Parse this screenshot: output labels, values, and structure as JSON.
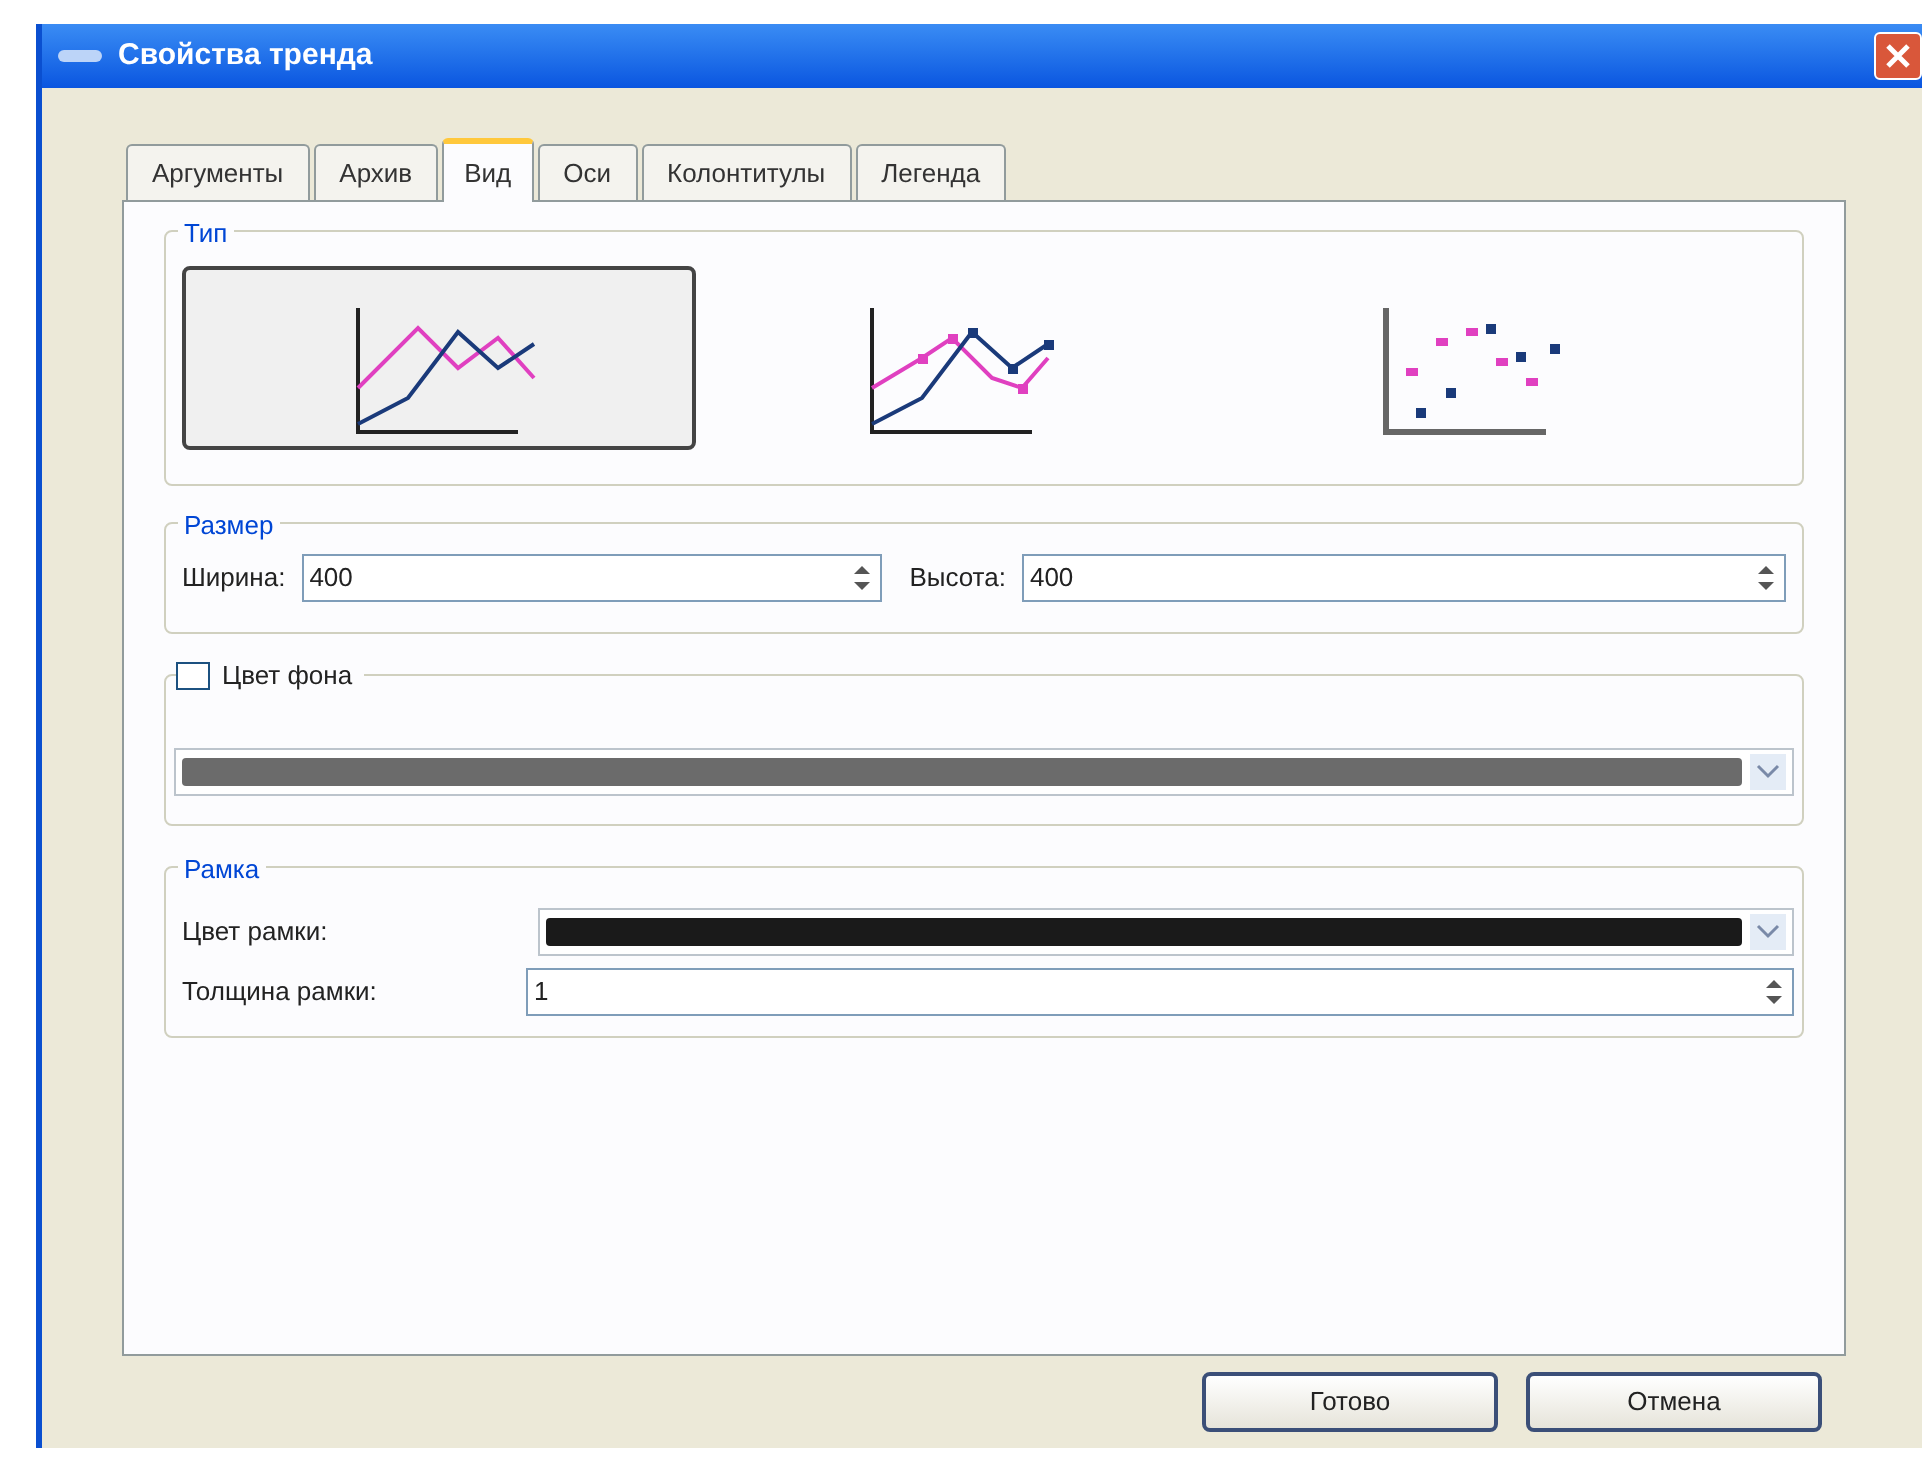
{
  "window": {
    "title": "Свойства тренда"
  },
  "tabs": [
    {
      "label": "Аргументы",
      "selected": false
    },
    {
      "label": "Архив",
      "selected": false
    },
    {
      "label": "Вид",
      "selected": true
    },
    {
      "label": "Оси",
      "selected": false
    },
    {
      "label": "Колонтитулы",
      "selected": false
    },
    {
      "label": "Легенда",
      "selected": false
    }
  ],
  "type_group": {
    "title": "Тип",
    "options": [
      {
        "kind": "line",
        "selected": true
      },
      {
        "kind": "line-markers",
        "selected": false
      },
      {
        "kind": "scatter",
        "selected": false
      }
    ]
  },
  "size_group": {
    "title": "Размер",
    "width_label": "Ширина:",
    "width_value": "400",
    "height_label": "Высота:",
    "height_value": "400"
  },
  "background_group": {
    "label": "Цвет фона",
    "checked": false,
    "color": "#6b6b6b"
  },
  "frame_group": {
    "title": "Рамка",
    "color_label": "Цвет рамки:",
    "color": "#1a1a1a",
    "thickness_label": "Толщина рамки:",
    "thickness_value": "1"
  },
  "buttons": [
    "Готово",
    "Отмена"
  ]
}
